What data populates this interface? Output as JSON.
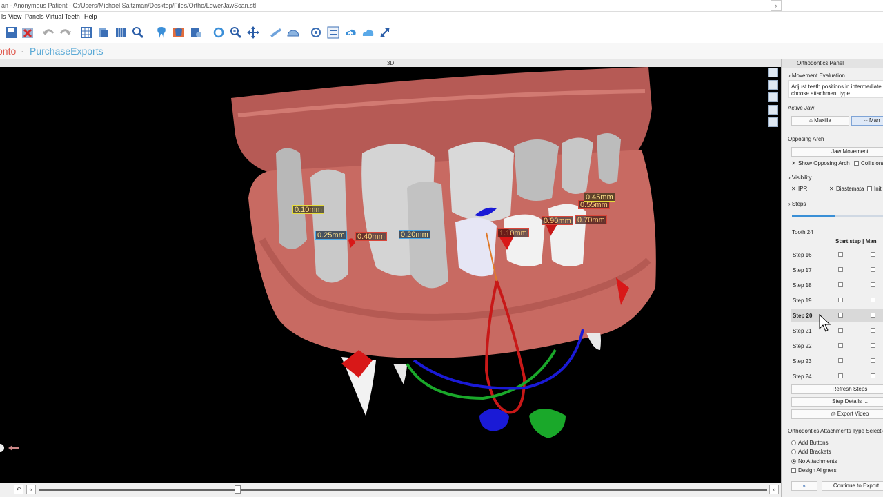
{
  "window": {
    "title": "an - Anonymous Patient - C:/Users/Michael Saltzman/Desktop/Files/Ortho/LowerJawScan.stl"
  },
  "menu": [
    "ls",
    "View",
    "Panels",
    "Virtual Teeth",
    "Help"
  ],
  "brand": {
    "lead": "onto",
    "dot": "·",
    "text": "PurchaseExports"
  },
  "viewport": {
    "header": "3D",
    "measurements": [
      {
        "label": "0.10mm",
        "style": "y"
      },
      {
        "label": "0.25mm",
        "style": "b"
      },
      {
        "label": "0.40mm",
        "style": "r"
      },
      {
        "label": "0.20mm",
        "style": "b"
      },
      {
        "label": "1.10mm",
        "style": "r"
      },
      {
        "label": "0.90mm",
        "style": "r"
      },
      {
        "label": "0.70mm",
        "style": "r"
      },
      {
        "label": "0.55mm",
        "style": "r"
      },
      {
        "label": "0.45mm",
        "style": "y"
      }
    ]
  },
  "panel": {
    "title": "Orthodontics Panel",
    "movement_evaluation": "Movement Evaluation",
    "description": "Adjust teeth positions in intermediate s choose attachment type.",
    "active_jaw": "Active Jaw",
    "maxilla": "Maxilla",
    "mandible": "Man",
    "opposing_arch": "Opposing Arch",
    "jaw_movement": "Jaw Movement",
    "show_opposing_arch": "Show Opposing Arch",
    "collisions": "Collisions",
    "visibility": "Visibility",
    "ipr": "IPR",
    "diastemata": "Diastemata",
    "initial": "Initi",
    "steps": "Steps",
    "steps_progress": 0.45,
    "tooth": "Tooth 24",
    "col_start": "Start step | Man",
    "step_rows": [
      "Step 16",
      "Step 17",
      "Step 18",
      "Step 19",
      "Step 20",
      "Step 21",
      "Step 22",
      "Step 23",
      "Step 24"
    ],
    "selected_step": "Step 20",
    "refresh_steps": "Refresh Steps",
    "step_details": "Step Details ...",
    "export_video": "Export Video",
    "attachments_title": "Orthodontics Attachments Type Selection",
    "add_buttons": "Add Buttons",
    "add_brackets": "Add Brackets",
    "no_attachments": "No Attachments",
    "design_aligners": "Design Aligners",
    "back": "«",
    "continue": "Continue to Export"
  }
}
